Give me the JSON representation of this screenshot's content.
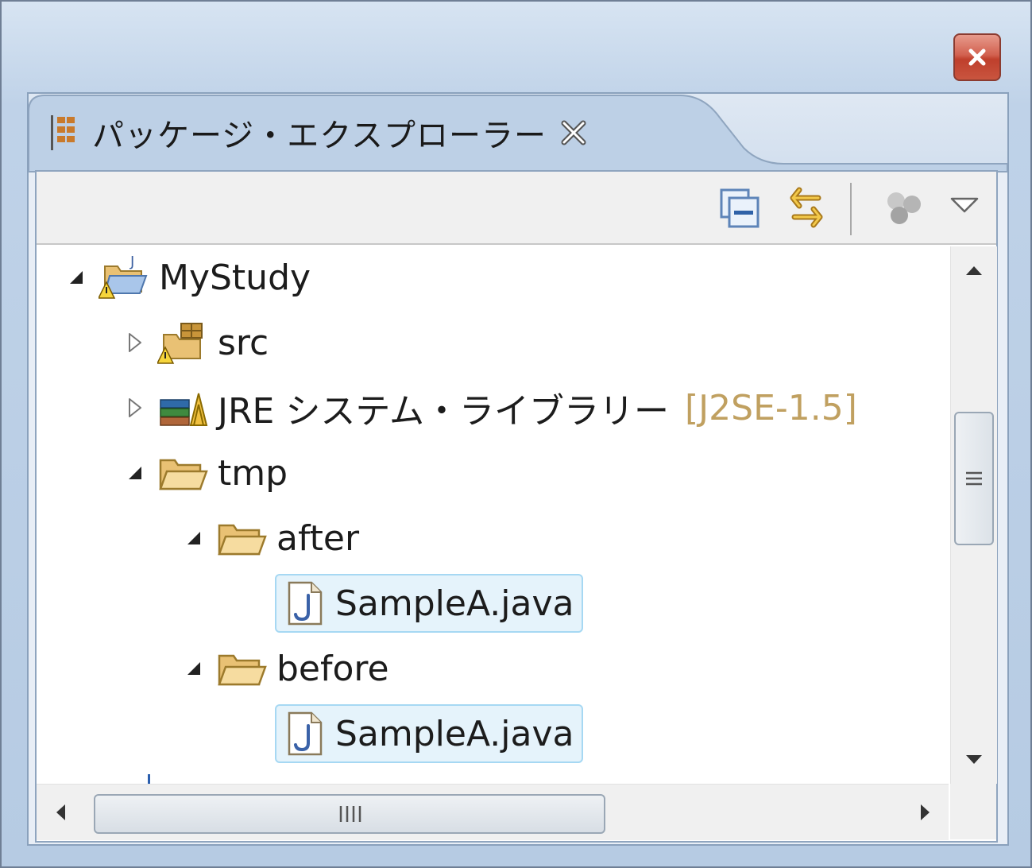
{
  "window": {
    "close_icon": "close-icon"
  },
  "view": {
    "tab_title": "パッケージ・エクスプローラー",
    "tab_icon": "package-explorer-icon",
    "tab_close_icon": "tab-close-icon"
  },
  "toolbar": {
    "collapse_all_icon": "collapse-all-icon",
    "link_editor_icon": "link-with-editor-icon",
    "focus_icon": "focus-on-active-task-icon",
    "view_menu_icon": "view-menu-icon"
  },
  "tree": {
    "nodes": [
      {
        "label": "MyStudy",
        "expanded": true,
        "icon": "java-project-warning-icon"
      },
      {
        "label": "src",
        "expanded": false,
        "icon": "source-folder-warning-icon"
      },
      {
        "label": "JRE システム・ライブラリー",
        "decoration": "[J2SE-1.5]",
        "expanded": false,
        "icon": "library-icon"
      },
      {
        "label": "tmp",
        "expanded": true,
        "icon": "folder-icon"
      },
      {
        "label": "after",
        "expanded": true,
        "icon": "folder-icon"
      },
      {
        "label": "SampleA.java",
        "selected": true,
        "icon": "java-file-icon"
      },
      {
        "label": "before",
        "expanded": true,
        "icon": "folder-icon"
      },
      {
        "label": "SampleA.java",
        "selected": true,
        "icon": "java-file-icon"
      }
    ]
  },
  "colors": {
    "selection_bg": "#e5f3fb",
    "selection_border": "#a6d8f3",
    "decoration_text": "#c0a060",
    "close_button": "#c9553f"
  }
}
